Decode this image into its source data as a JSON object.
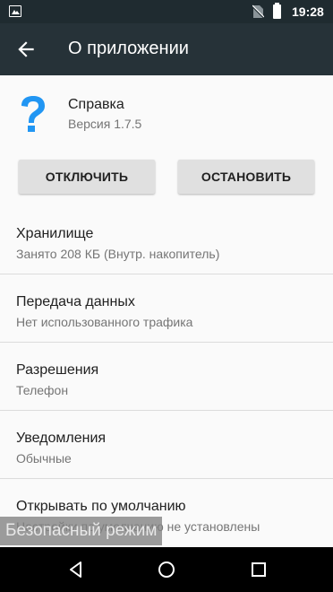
{
  "status_bar": {
    "time": "19:28"
  },
  "app_bar": {
    "title": "О приложении"
  },
  "app": {
    "name": "Справка",
    "version": "Версия 1.7.5"
  },
  "buttons": {
    "disable": "ОТКЛЮЧИТЬ",
    "stop": "ОСТАНОВИТЬ"
  },
  "settings": [
    {
      "title": "Хранилище",
      "subtitle": "Занято 208  КБ (Внутр. накопитель)"
    },
    {
      "title": "Передача данных",
      "subtitle": "Нет использованного трафика"
    },
    {
      "title": "Разрешения",
      "subtitle": "Телефон"
    },
    {
      "title": "Уведомления",
      "subtitle": "Обычные"
    },
    {
      "title": "Открывать по умолчанию",
      "subtitle": "Настройки по умолчанию не установлены"
    }
  ],
  "toast": {
    "text": "Безопасный режим"
  },
  "colors": {
    "app_bar": "#263238",
    "status_bar": "#1f2b30",
    "help_icon": "#2196f3"
  }
}
